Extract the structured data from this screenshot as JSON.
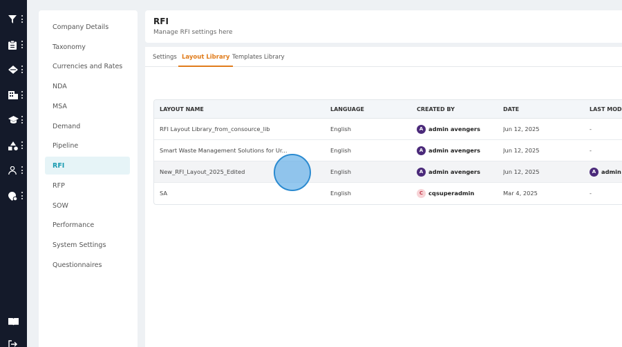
{
  "rail": {
    "icons": [
      "filter-icon",
      "clipboard-icon",
      "tag-icon",
      "building-icon",
      "graduation-cap-icon",
      "shapes-icon",
      "user-icon",
      "location-settings-icon",
      "book-icon",
      "logout-icon"
    ]
  },
  "nav": {
    "items": [
      {
        "label": "Company Details"
      },
      {
        "label": "Taxonomy"
      },
      {
        "label": "Currencies and Rates"
      },
      {
        "label": "NDA"
      },
      {
        "label": "MSA"
      },
      {
        "label": "Demand"
      },
      {
        "label": "Pipeline"
      },
      {
        "label": "RFI"
      },
      {
        "label": "RFP"
      },
      {
        "label": "SOW"
      },
      {
        "label": "Performance"
      },
      {
        "label": "System Settings"
      },
      {
        "label": "Questionnaires"
      }
    ],
    "active": "RFI"
  },
  "header": {
    "title": "RFI",
    "subtitle": "Manage RFI settings here"
  },
  "tabs": [
    {
      "label": "Settings"
    },
    {
      "label": "Layout Library"
    },
    {
      "label": "Templates Library"
    }
  ],
  "active_tab": "Layout Library",
  "table": {
    "columns": [
      "LAYOUT NAME",
      "LANGUAGE",
      "CREATED BY",
      "DATE",
      "LAST MODI"
    ],
    "rows": [
      {
        "name": "RFI Layout Library_from_consource_lib",
        "language": "English",
        "created_by": "admin avengers",
        "avatar": "A",
        "date": "Jun 12, 2025",
        "last_modified": "-"
      },
      {
        "name": "Smart Waste Management Solutions for Ur...",
        "language": "English",
        "created_by": "admin avengers",
        "avatar": "A",
        "date": "Jun 12, 2025",
        "last_modified": "-"
      },
      {
        "name": "New_RFI_Layout_2025_Edited",
        "language": "English",
        "created_by": "admin avengers",
        "avatar": "A",
        "date": "Jun 12, 2025",
        "last_modified": "admin"
      },
      {
        "name": "SA",
        "language": "English",
        "created_by": "cqsuperadmin",
        "avatar": "C",
        "date": "Mar 4, 2025",
        "last_modified": "-"
      }
    ]
  },
  "colors": {
    "rail_bg": "#141a2a",
    "accent_orange": "#e07b1a",
    "active_nav": "#1a9bb0",
    "avatar_purple": "#4b2a7a"
  }
}
